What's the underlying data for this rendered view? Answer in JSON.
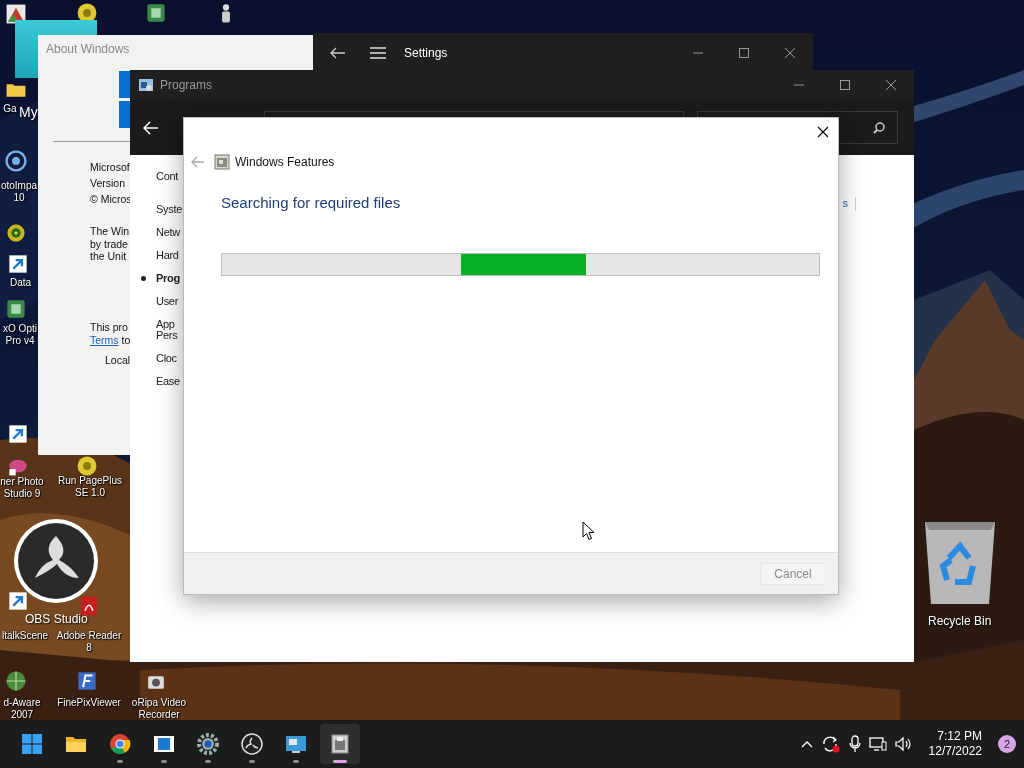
{
  "desktop": {
    "icons": [
      {
        "kind": "tile"
      },
      {
        "kind": "disc"
      },
      {
        "kind": "app"
      },
      {
        "kind": "figure"
      },
      {
        "kind": "folder",
        "label": "Ga"
      },
      {
        "kind": "target",
        "label": "otoImpa\n10"
      },
      {
        "kind": "spiral"
      },
      {
        "kind": "shortcut",
        "label": "Data"
      },
      {
        "kind": "app",
        "label": "xO Opti\nPro v4"
      },
      {
        "kind": "shortcut"
      },
      {
        "label": "ner Photo\nStudio 9"
      },
      {
        "kind": "disc",
        "label": "Run PagePlus\nSE 1.0"
      },
      {
        "kind": "shortcut",
        "label": "ltalkScene"
      },
      {
        "kind": "pdf",
        "label": "Adobe Reader\n8"
      },
      {
        "kind": "globe",
        "label": "d-Aware\n2007"
      },
      {
        "kind": "viewer",
        "label": "FinePixViewer"
      },
      {
        "kind": "camera",
        "label": "oRipa Video\nRecorder"
      }
    ],
    "dragged_item": {
      "label": "My"
    },
    "obs": {
      "label": "OBS Studio"
    },
    "recycle_bin": {
      "label": "Recycle Bin"
    }
  },
  "about_window": {
    "title": "About Windows",
    "lines": [
      "Microsof",
      "Version",
      "© Micros"
    ],
    "paragraph": "The Win\nby trade\nthe Unit",
    "license": {
      "text": "This pro",
      "link": "Terms",
      "after": "to"
    },
    "local": "Local"
  },
  "settings_window": {
    "title": "Settings"
  },
  "programs_window": {
    "title": "Programs",
    "nav": [
      {
        "label": "Cont",
        "kind": "home",
        "selected": false
      },
      {
        "label": "Syste",
        "kind": "item",
        "selected": false
      },
      {
        "label": "Netw",
        "kind": "item",
        "selected": false
      },
      {
        "label": "Hard",
        "kind": "item",
        "selected": false
      },
      {
        "label": "Prog",
        "kind": "item",
        "selected": true
      },
      {
        "label": "User",
        "kind": "item",
        "selected": false
      },
      {
        "label": "App\nPers",
        "kind": "item",
        "selected": false
      },
      {
        "label": "Cloc",
        "kind": "item",
        "selected": false
      },
      {
        "label": "Ease",
        "kind": "item",
        "selected": false
      }
    ],
    "link_fragment": "s"
  },
  "features_dialog": {
    "title": "Windows Features",
    "heading": "Searching for required files",
    "progress": {
      "indeterminate": true
    },
    "cancel": {
      "label": "Cancel",
      "disabled": true
    }
  },
  "taskbar": {
    "apps": [
      {
        "kind": "start",
        "running": false,
        "active": false
      },
      {
        "kind": "folder",
        "running": false,
        "active": false
      },
      {
        "kind": "chrome",
        "running": true,
        "active": false
      },
      {
        "kind": "film",
        "running": true,
        "active": false
      },
      {
        "kind": "gear",
        "running": true,
        "active": false
      },
      {
        "kind": "obs",
        "running": true,
        "active": false
      },
      {
        "kind": "monitor",
        "running": true,
        "active": false
      },
      {
        "kind": "features",
        "running": true,
        "active": true
      }
    ],
    "time": "7:12 PM",
    "date": "12/7/2022",
    "notifications": "2"
  }
}
